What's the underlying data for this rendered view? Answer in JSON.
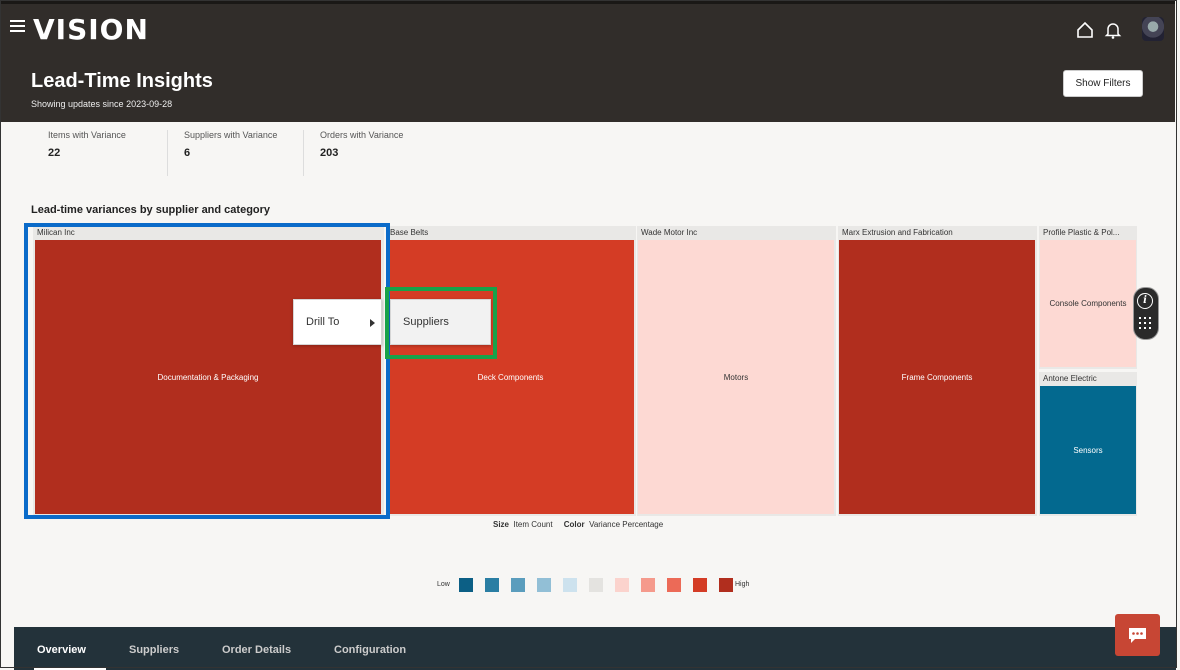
{
  "app": {
    "logo": "VISION"
  },
  "header": {
    "title": "Lead-Time Insights",
    "subtitle": "Showing updates since 2023-09-28",
    "show_filters_label": "Show Filters"
  },
  "metrics": [
    {
      "label": "Items with Variance",
      "value": "22"
    },
    {
      "label": "Suppliers with Variance",
      "value": "6"
    },
    {
      "label": "Orders with Variance",
      "value": "203"
    }
  ],
  "treemap": {
    "title": "Lead-time variances by supplier and category",
    "groups": [
      {
        "supplier": "Milican Inc",
        "cells": [
          {
            "label": "Documentation & Packaging",
            "color": "#b12e1e"
          }
        ]
      },
      {
        "supplier": "Base Belts",
        "cells": [
          {
            "label": "Deck Components",
            "color": "#d43c25"
          }
        ]
      },
      {
        "supplier": "Wade Motor Inc",
        "cells": [
          {
            "label": "Motors",
            "color": "#fdd9d3"
          }
        ]
      },
      {
        "supplier": "Marx Extrusion and Fabrication",
        "cells": [
          {
            "label": "Frame Components",
            "color": "#b12e1e"
          }
        ]
      },
      {
        "supplier": "Profile Plastic & Pol...",
        "cells": [
          {
            "label": "Console Components",
            "color": "#fdd9d3"
          }
        ]
      },
      {
        "supplier": "Antone Electric",
        "cells": [
          {
            "label": "Sensors",
            "color": "#03698f"
          }
        ]
      }
    ],
    "size_label": "Size",
    "size_value": "Item Count",
    "color_label": "Color",
    "color_value": "Variance Percentage"
  },
  "context_menu": {
    "drill_to_label": "Drill To",
    "submenu_item": "Suppliers"
  },
  "legend": {
    "low_label": "Low",
    "high_label": "High",
    "colors": [
      "#0c5f85",
      "#2a7ea3",
      "#5b9dbd",
      "#92bfd6",
      "#cde2ee",
      "#e4e3e0",
      "#fbd3cd",
      "#f59a8c",
      "#ec6a57",
      "#d43c25",
      "#b12e1e"
    ]
  },
  "bottom_nav": {
    "tabs": [
      "Overview",
      "Suppliers",
      "Order Details",
      "Configuration"
    ],
    "active": "Overview"
  },
  "colors": {
    "header_bg": "#312d2a",
    "nav_bg": "#23323a",
    "chat_button": "#c74634",
    "highlight_blue": "#0b6bc9",
    "highlight_green": "#17a24a"
  },
  "icons": [
    "hamburger-icon",
    "home-icon",
    "bell-icon",
    "avatar",
    "info-icon",
    "grid-dots-icon",
    "chat-icon",
    "chevron-right-icon"
  ]
}
